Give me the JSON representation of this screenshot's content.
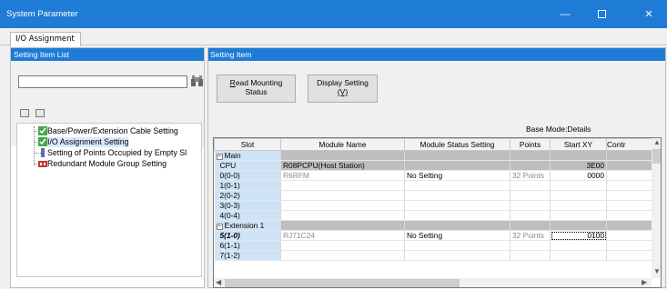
{
  "window": {
    "title": "System Parameter"
  },
  "tabs": [
    {
      "label": "I/O Assignment"
    }
  ],
  "left_pane": {
    "header": "Setting Item List",
    "search_placeholder": "",
    "tree": [
      {
        "label": "Base/Power/Extension Cable Setting",
        "icon": "green-check-module-icon"
      },
      {
        "label": "I/O Assignment Setting",
        "icon": "green-check-module-icon",
        "selected": true
      },
      {
        "label": "Setting of Points Occupied by Empty Sl",
        "icon": "blue-bar-icon"
      },
      {
        "label": "Redundant Module Group Setting",
        "icon": "red-module-icon"
      }
    ]
  },
  "right_pane": {
    "header": "Setting Item",
    "read_mounting_status": {
      "line1": "Read Mounting",
      "line1_accel": "R",
      "line1_rest": "ead Mounting",
      "line2": "Status"
    },
    "display_setting": {
      "line1": "Display Setting",
      "line2": "(V)"
    },
    "base_mode": "Base Mode:Details",
    "columns": [
      "Slot",
      "Module Name",
      "Module Status Setting",
      "Points",
      "Start XY",
      "Contr"
    ],
    "rows": [
      {
        "type": "group",
        "slot": "Main"
      },
      {
        "type": "cpu",
        "slot": "CPU",
        "module": "R08PCPU(Host Station)",
        "status": "",
        "points": "",
        "start": "3E00"
      },
      {
        "type": "data",
        "slot": "0(0-0)",
        "module": "R6RFM",
        "status": "No Setting",
        "points": "32 Points",
        "start": "0000"
      },
      {
        "type": "data",
        "slot": "1(0-1)",
        "module": "",
        "status": "",
        "points": "",
        "start": ""
      },
      {
        "type": "data",
        "slot": "2(0-2)",
        "module": "",
        "status": "",
        "points": "",
        "start": ""
      },
      {
        "type": "data",
        "slot": "3(0-3)",
        "module": "",
        "status": "",
        "points": "",
        "start": ""
      },
      {
        "type": "data",
        "slot": "4(0-4)",
        "module": "",
        "status": "",
        "points": "",
        "start": ""
      },
      {
        "type": "group",
        "slot": "Extension 1"
      },
      {
        "type": "data",
        "slot": "5(1-0)",
        "module": "RJ71C24",
        "status": "No Setting",
        "points": "32 Points",
        "start": "0100",
        "emph": true,
        "focus": true
      },
      {
        "type": "data",
        "slot": "6(1-1)",
        "module": "",
        "status": "",
        "points": "",
        "start": ""
      },
      {
        "type": "data",
        "slot": "7(1-2)",
        "module": "",
        "status": "",
        "points": "",
        "start": ""
      }
    ]
  },
  "colors": {
    "accent": "#1e7bd6",
    "slot_bg": "#cfe3f7",
    "group_bg": "#bebebe"
  }
}
